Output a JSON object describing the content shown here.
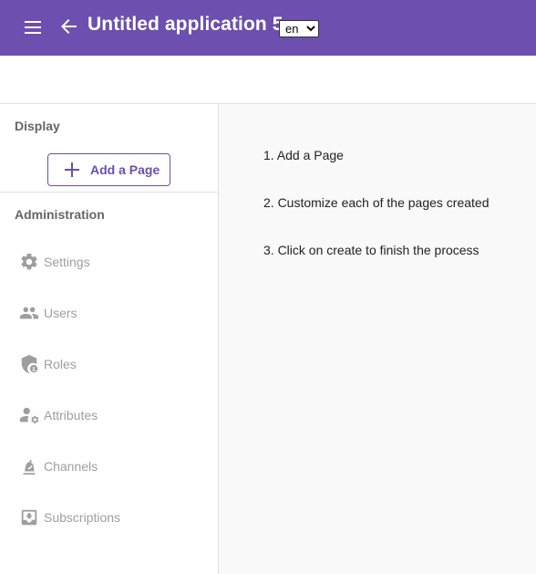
{
  "header": {
    "title": "Untitled application 5",
    "language": "en",
    "language_options": [
      "en"
    ]
  },
  "sidebar": {
    "display_section": "Display",
    "add_page_label": "Add a Page",
    "admin_section": "Administration",
    "items": [
      {
        "label": "Settings",
        "icon": "gear-icon"
      },
      {
        "label": "Users",
        "icon": "users-icon"
      },
      {
        "label": "Roles",
        "icon": "shield-icon"
      },
      {
        "label": "Attributes",
        "icon": "user-gear-icon"
      },
      {
        "label": "Channels",
        "icon": "channel-icon"
      },
      {
        "label": "Subscriptions",
        "icon": "inbox-download-icon"
      }
    ]
  },
  "main": {
    "steps": [
      "1. Add a Page",
      "2. Customize each of the pages created",
      "3. Click on create to finish the process"
    ]
  },
  "colors": {
    "primary": "#6c4fae",
    "icon_gray": "#9e9e9e"
  }
}
